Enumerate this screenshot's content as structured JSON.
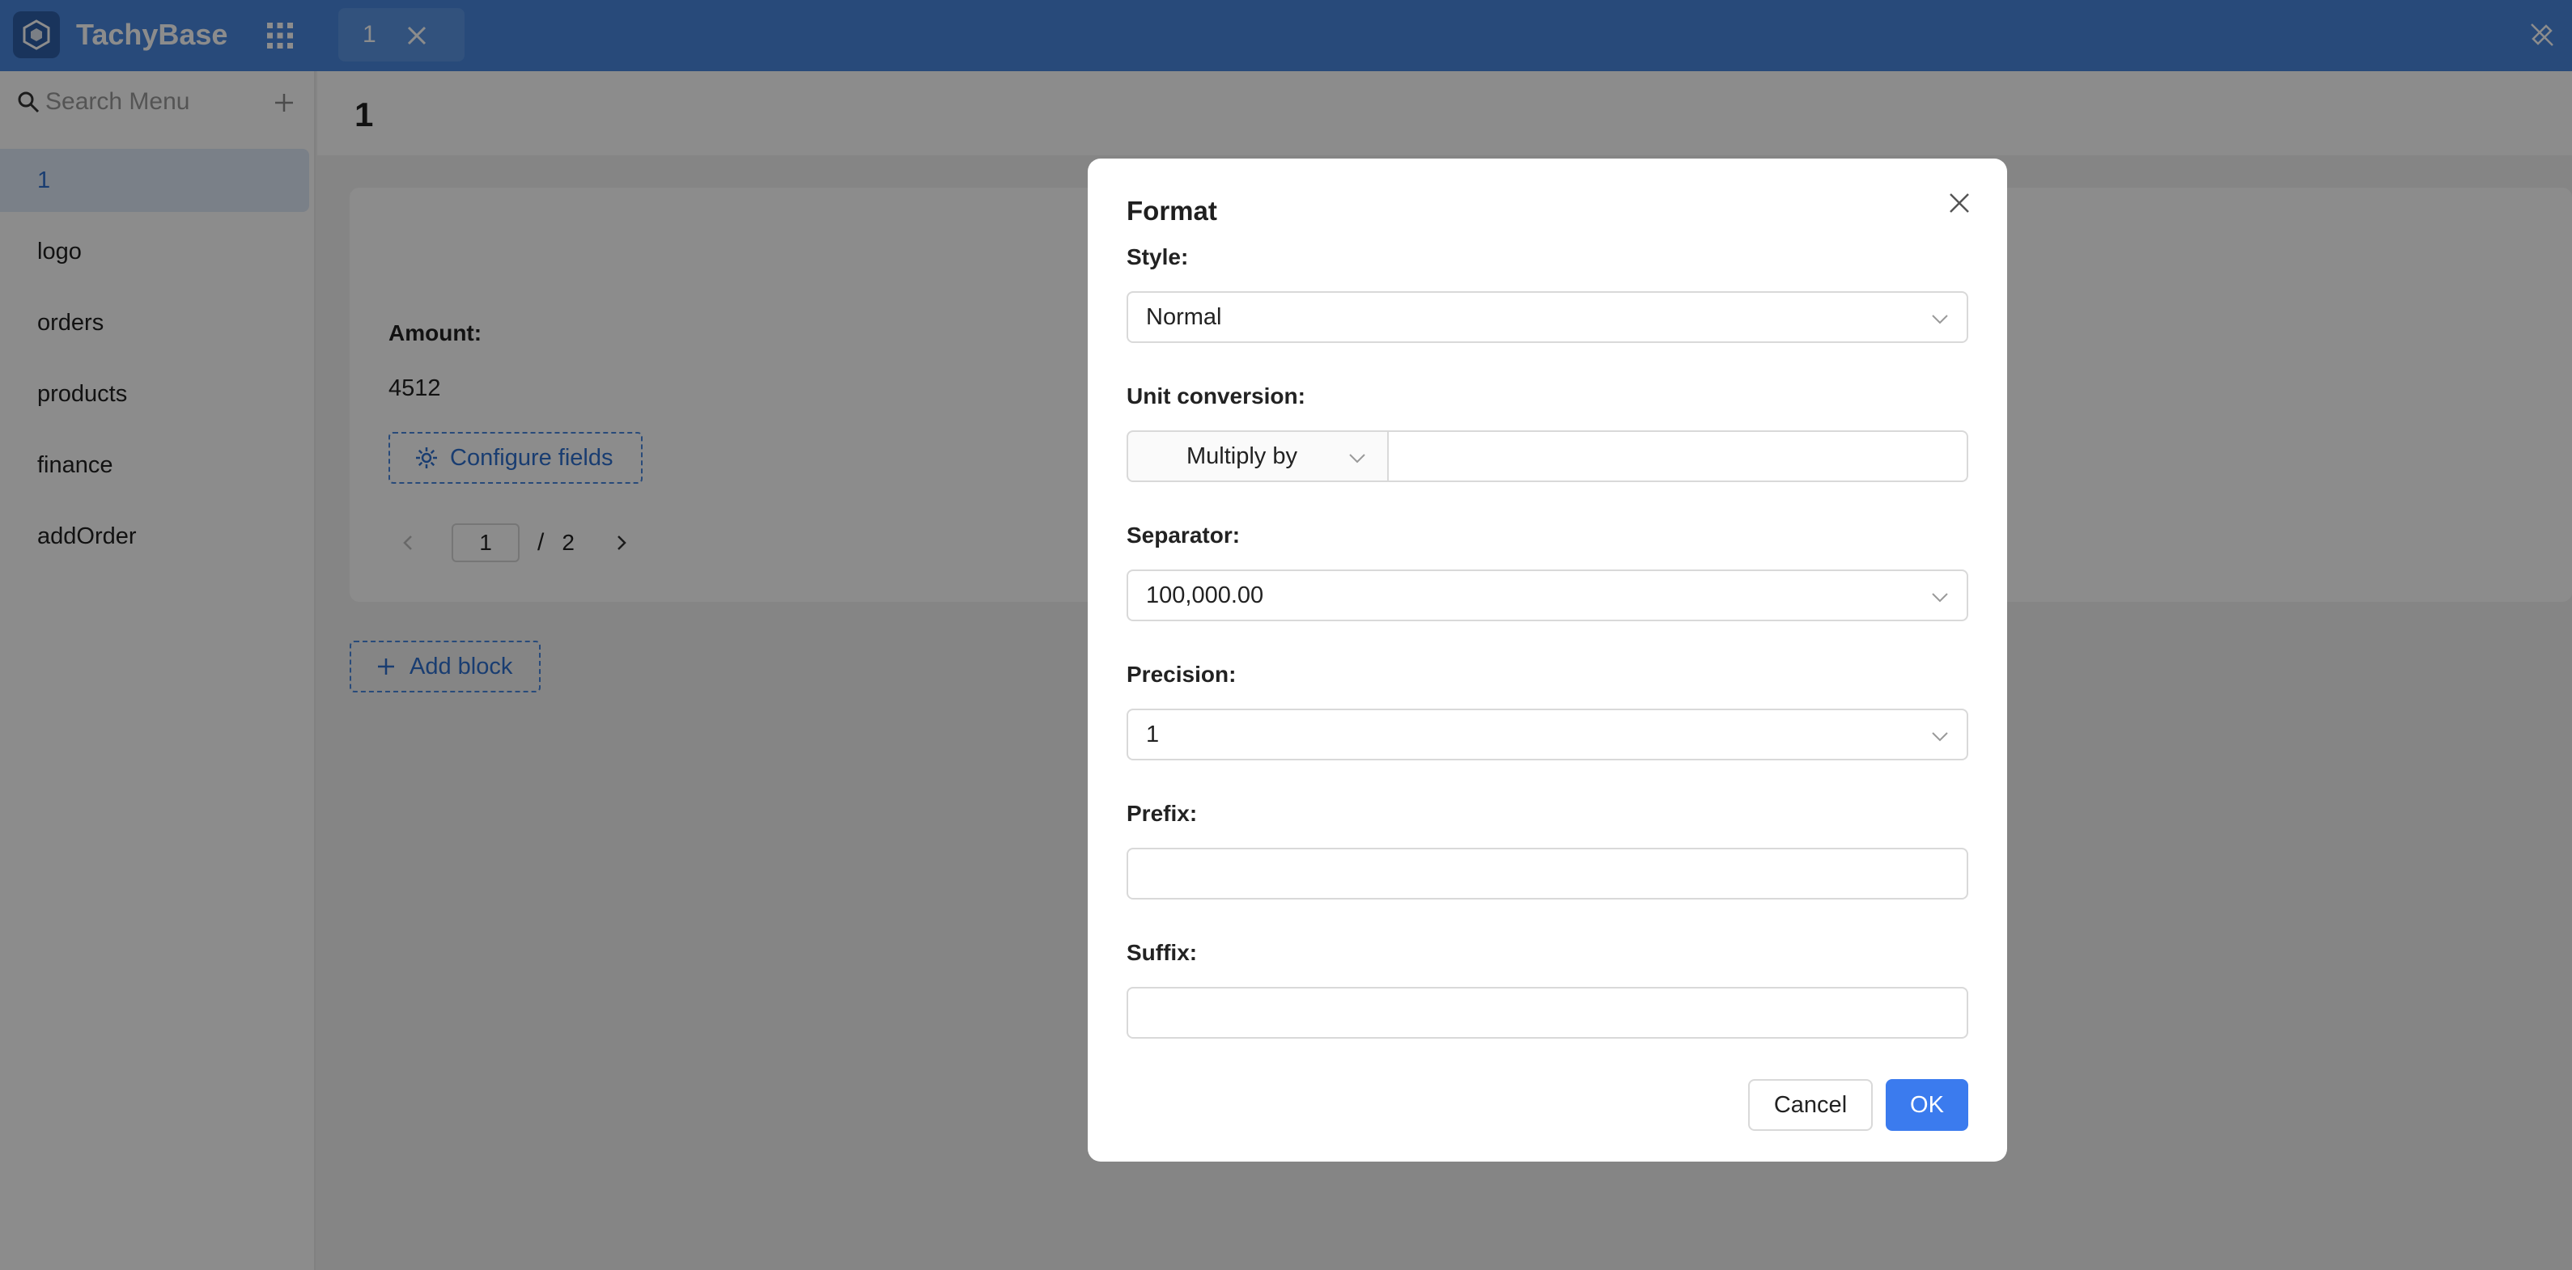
{
  "header": {
    "brand": "TachyBase",
    "tab_label": "1",
    "colors": {
      "header_bg": "#4a88df",
      "accent": "#2f6fce",
      "primary_button": "#3b7bee"
    }
  },
  "sidebar": {
    "search_placeholder": "Search Menu",
    "items": [
      {
        "label": "1",
        "active": true
      },
      {
        "label": "logo",
        "active": false
      },
      {
        "label": "orders",
        "active": false
      },
      {
        "label": "products",
        "active": false
      },
      {
        "label": "finance",
        "active": false
      },
      {
        "label": "addOrder",
        "active": false
      }
    ]
  },
  "main": {
    "page_title": "1",
    "field_label": "Amount",
    "field_value": "4512",
    "configure_fields_label": "Configure fields",
    "pagination": {
      "current": "1",
      "separator": "/",
      "total": "2"
    },
    "add_block_label": "Add block"
  },
  "modal": {
    "title": "Format",
    "style": {
      "label": "Style",
      "value": "Normal"
    },
    "unit_conversion": {
      "label": "Unit conversion",
      "operator": "Multiply by",
      "value": ""
    },
    "separator": {
      "label": "Separator",
      "value": "100,000.00"
    },
    "precision": {
      "label": "Precision",
      "value": "1"
    },
    "prefix": {
      "label": "Prefix",
      "value": ""
    },
    "suffix": {
      "label": "Suffix",
      "value": ""
    },
    "cancel_label": "Cancel",
    "ok_label": "OK"
  }
}
